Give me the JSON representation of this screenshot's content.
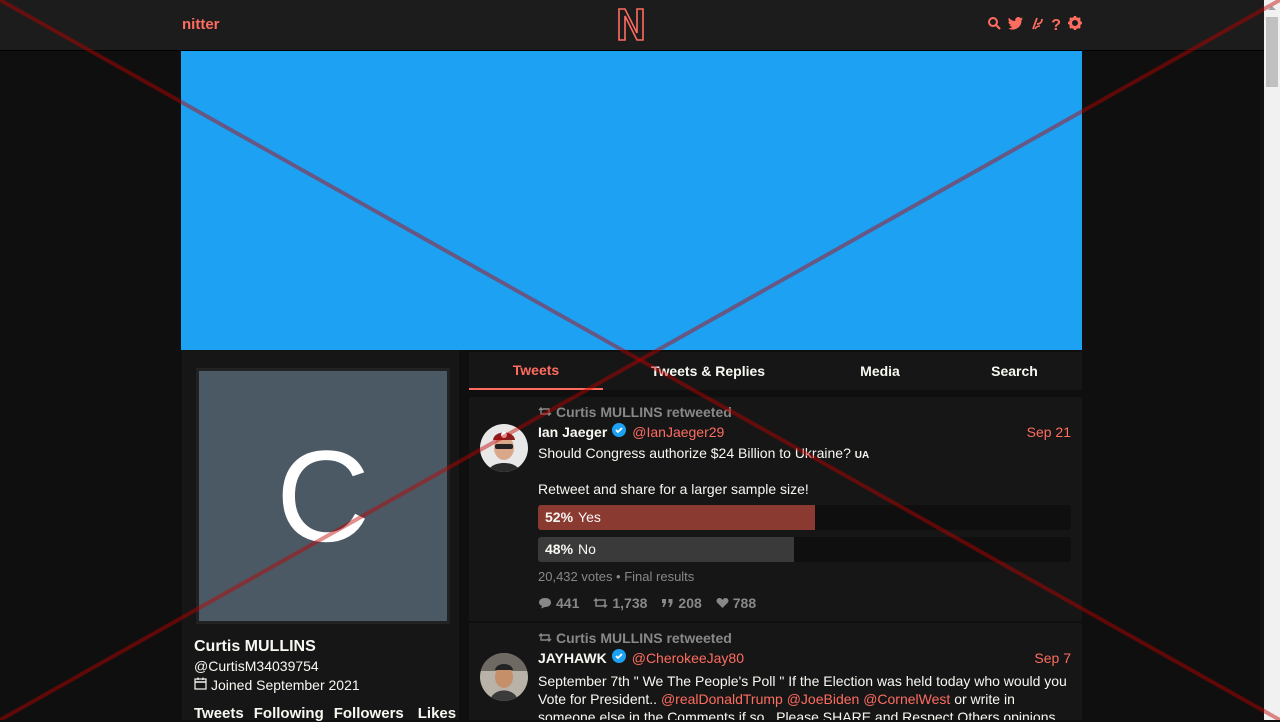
{
  "nav": {
    "brand": "nitter",
    "icons": [
      "search-icon",
      "twitter-icon",
      "rss-icon",
      "help-icon",
      "settings-icon"
    ]
  },
  "colors": {
    "accent": "#ff6c60",
    "banner": "#1da1f2",
    "avatar_bg": "#4b5965",
    "poll_yes": "#8b3a32",
    "poll_no": "#3a3a3a"
  },
  "profile": {
    "avatar_letter": "C",
    "fullname": "Curtis MULLINS",
    "username": "@CurtisM34039754",
    "joined": "Joined September 2021",
    "stats": [
      "Tweets",
      "Following",
      "Followers",
      "Likes"
    ]
  },
  "tabs": [
    "Tweets",
    "Tweets & Replies",
    "Media",
    "Search"
  ],
  "tweets": [
    {
      "retweet_header": "Curtis MULLINS retweeted",
      "name": "Ian Jaeger",
      "username": "@IanJaeger29",
      "date": "Sep 21",
      "text_line1": "Should Congress authorize $24 Billion to Ukraine?",
      "flag": "UA",
      "text_line2": "Retweet and share for a larger sample size!",
      "poll": [
        {
          "percent_label": "52%",
          "label": "Yes",
          "fraction": 0.52
        },
        {
          "percent_label": "48%",
          "label": "No",
          "fraction": 0.48
        }
      ],
      "poll_info": "20,432 votes • Final results",
      "replies": "441",
      "retweets": "1,738",
      "quotes": "208",
      "likes": "788"
    },
    {
      "retweet_header": "Curtis MULLINS retweeted",
      "name": "JAYHAWK",
      "username": "@CherokeeJay80",
      "date": "Sep 7",
      "text_line1": "September 7th \" We The People's Poll \" If the Election was held today who would you",
      "text_line2_prefix": "Vote for President..",
      "mention1": "@realDonaldTrump",
      "mention2": "@JoeBiden",
      "mention3": "@CornelWest",
      "text_line2_suffix": "or write in",
      "text_line3": "someone else in the Comments if so . Please SHARE and Respect Others opinions"
    }
  ]
}
